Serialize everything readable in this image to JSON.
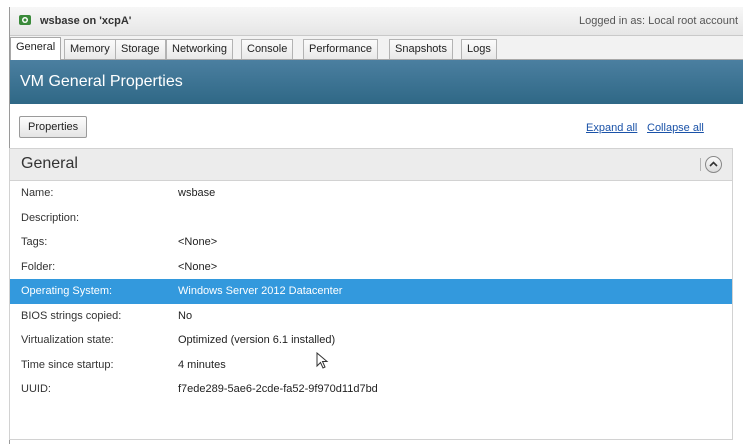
{
  "window": {
    "title": "wsbase on 'xcpA'",
    "login_label": "Logged in as:",
    "login_user": "Local root account"
  },
  "tabs": [
    {
      "label": "General",
      "active": true
    },
    {
      "label": "Memory"
    },
    {
      "label": "Storage"
    },
    {
      "label": "Networking"
    },
    {
      "label": "Console"
    },
    {
      "label": "Performance"
    },
    {
      "label": "Snapshots"
    },
    {
      "label": "Logs"
    }
  ],
  "banner": {
    "title": "VM General Properties"
  },
  "toolbar": {
    "properties_label": "Properties",
    "expand_all": "Expand all",
    "collapse_all": "Collapse all"
  },
  "section": {
    "title": "General",
    "rows": [
      {
        "key": "Name:",
        "value": "wsbase"
      },
      {
        "key": "Description:",
        "value": ""
      },
      {
        "key": "Tags:",
        "value": "<None>"
      },
      {
        "key": "Folder:",
        "value": "<None>"
      },
      {
        "key": "Operating System:",
        "value": "Windows Server 2012 Datacenter",
        "selected": true
      },
      {
        "key": "BIOS strings copied:",
        "value": "No"
      },
      {
        "key": "Virtualization state:",
        "value": "Optimized (version 6.1 installed)"
      },
      {
        "key": "Time since startup:",
        "value": "4 minutes"
      },
      {
        "key": "UUID:",
        "value": "f7ede289-5ae6-2cde-fa52-9f970d11d7bd"
      }
    ]
  },
  "icons": {
    "app": "xencenter-vm-icon",
    "toggle": "chevron-up-icon",
    "cursor": "mouse-pointer-icon"
  },
  "colors": {
    "banner": "#2f6886",
    "selection": "#3399dd",
    "link": "#1a52a8"
  }
}
